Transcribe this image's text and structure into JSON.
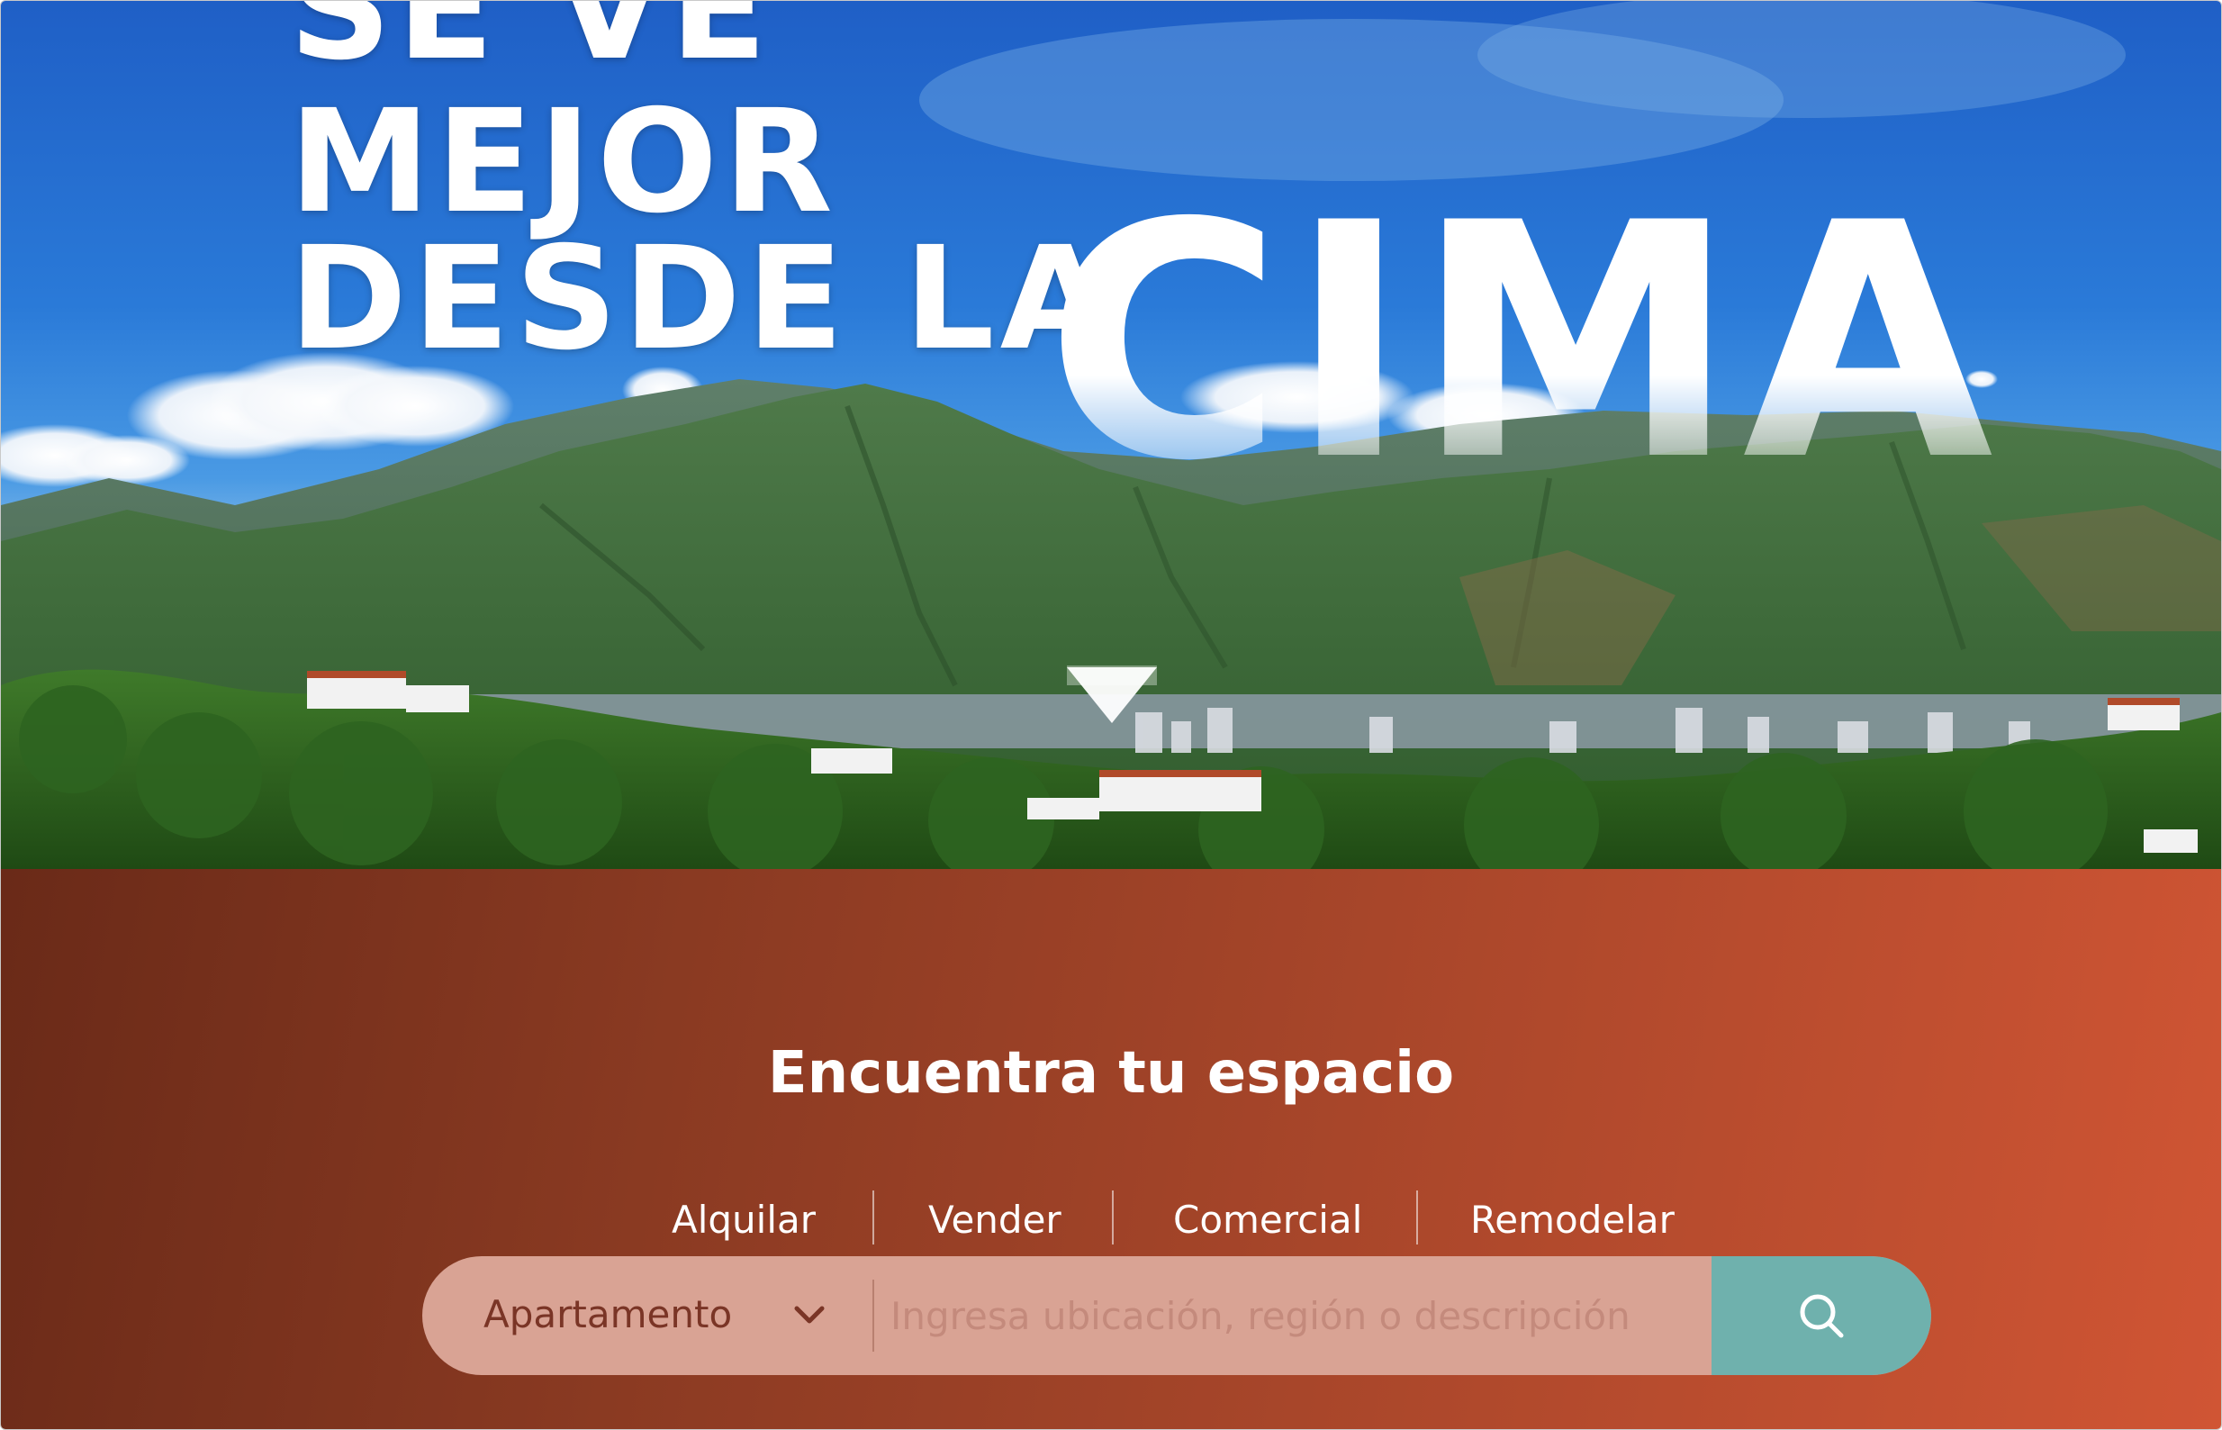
{
  "hero": {
    "headline_line1": "SE VE",
    "headline_line2": "MEJOR",
    "headline_line3": "DESDE LA",
    "headline_emphasis": "CIMA",
    "scroll_icon": "triangle-down-icon"
  },
  "search": {
    "title": "Encuentra tu espacio",
    "tabs": [
      {
        "label": "Alquilar"
      },
      {
        "label": "Vender"
      },
      {
        "label": "Comercial"
      },
      {
        "label": "Remodelar"
      }
    ],
    "property_type": "Apartamento",
    "dropdown_icon": "chevron-down-icon",
    "placeholder": "Ingresa ubicación, región o descripción",
    "search_icon": "search-icon"
  },
  "colors": {
    "section_gradient_start": "#6a2a18",
    "section_gradient_end": "#d05534",
    "search_bar_bg": "#d9a394",
    "search_button_bg": "#6fb1ad",
    "select_text": "#7a3526"
  }
}
